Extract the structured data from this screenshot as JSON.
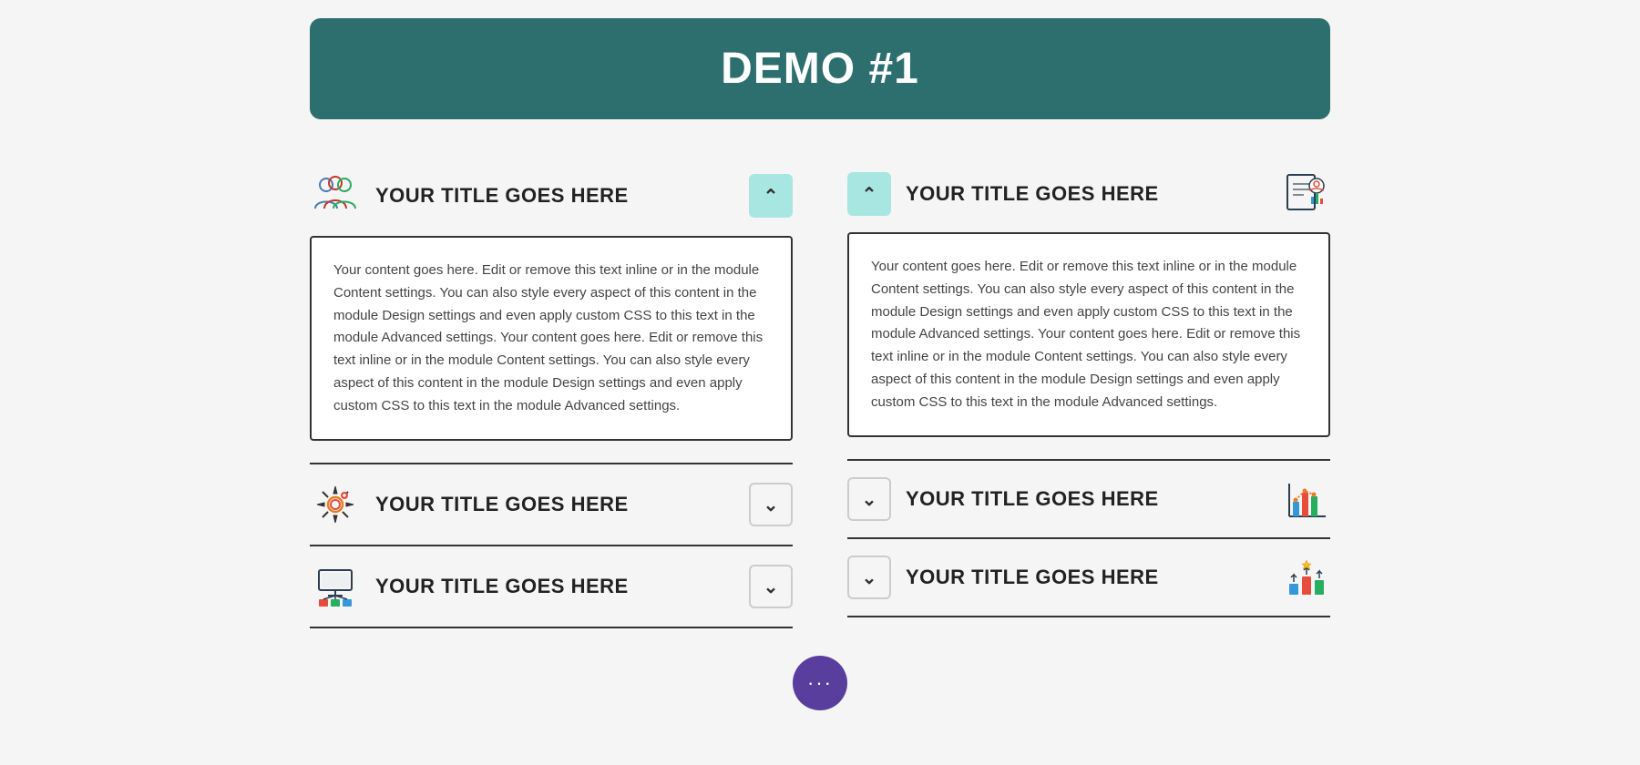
{
  "header": {
    "title": "DEMO #1"
  },
  "left_column": [
    {
      "id": "left-1",
      "title": "YOUR TITLE GOES HERE",
      "open": true,
      "icon_type": "people",
      "chevron_side": "right",
      "content": "Your content goes here. Edit or remove this text inline or in the module Content settings. You can also style every aspect of this content in the module Design settings and even apply custom CSS to this text in the module Advanced settings. Your content goes here. Edit or remove this text inline or in the module Content settings. You can also style every aspect of this content in the module Design settings and even apply custom CSS to this text in the module Advanced settings."
    },
    {
      "id": "left-2",
      "title": "YOUR TITLE GOES HERE",
      "open": false,
      "icon_type": "settings",
      "chevron_side": "right",
      "content": ""
    },
    {
      "id": "left-3",
      "title": "YOUR TITLE GOES HERE",
      "open": false,
      "icon_type": "database",
      "chevron_side": "right",
      "content": ""
    }
  ],
  "right_column": [
    {
      "id": "right-1",
      "title": "YOUR TITLE GOES HERE",
      "open": true,
      "icon_type": "report",
      "chevron_side": "left",
      "content": "Your content goes here. Edit or remove this text inline or in the module Content settings. You can also style every aspect of this content in the module Design settings and even apply custom CSS to this text in the module Advanced settings. Your content goes here. Edit or remove this text inline or in the module Content settings. You can also style every aspect of this content in the module Design settings and even apply custom CSS to this text in the module Advanced settings."
    },
    {
      "id": "right-2",
      "title": "YOUR TITLE GOES HERE",
      "open": false,
      "icon_type": "chart",
      "chevron_side": "left",
      "content": ""
    },
    {
      "id": "right-3",
      "title": "YOUR TITLE GOES HERE",
      "open": false,
      "icon_type": "growth",
      "chevron_side": "left",
      "content": ""
    }
  ],
  "chat_label": "···"
}
